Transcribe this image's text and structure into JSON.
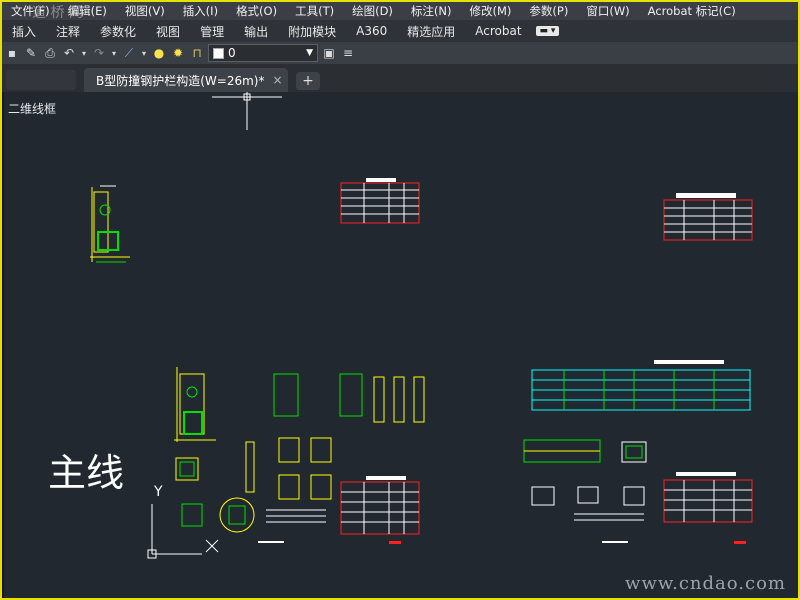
{
  "menu": [
    "文件(F)",
    "编辑(E)",
    "视图(V)",
    "插入(I)",
    "格式(O)",
    "工具(T)",
    "绘图(D)",
    "标注(N)",
    "修改(M)",
    "参数(P)",
    "窗口(W)",
    "Acrobat 标记(C)"
  ],
  "ribbon_tabs": [
    "插入",
    "注释",
    "参数化",
    "视图",
    "管理",
    "输出",
    "附加模块",
    "A360",
    "精选应用",
    "Acrobat"
  ],
  "layer": {
    "name": "0"
  },
  "document_tab": {
    "title": "B型防撞钢护栏构造(W=26m)*",
    "close": "×"
  },
  "add_tab": "+",
  "canvas": {
    "view_label": "二维线框",
    "big_label": "主线",
    "ucs_y": "Y",
    "watermark": "www.cndao.com",
    "watermark_top": "道 桥 网"
  },
  "colors": {
    "canvas_bg": "#212830",
    "frame": "#e8e000",
    "green": "#00e000",
    "yellow": "#ffff00",
    "cyan": "#00ffff",
    "red": "#ff2020"
  }
}
